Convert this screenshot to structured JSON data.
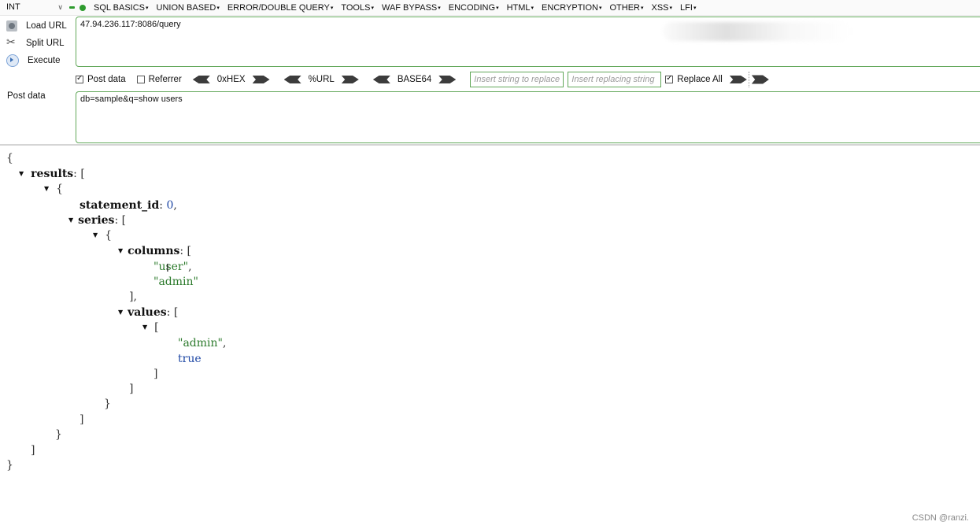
{
  "menubar": {
    "select_value": "INT",
    "items": [
      "SQL BASICS",
      "UNION BASED",
      "ERROR/DOUBLE QUERY",
      "TOOLS",
      "WAF BYPASS",
      "ENCODING",
      "HTML",
      "ENCRYPTION",
      "OTHER",
      "XSS",
      "LFI"
    ]
  },
  "actions": {
    "load_url": "Load URL",
    "split_url": "Split URL",
    "execute": "Execute"
  },
  "url_box": {
    "value": "47.94.236.117:8086/query"
  },
  "toolbar": {
    "post_data": "Post data",
    "referrer": "Referrer",
    "hex": "0xHEX",
    "url": "%URL",
    "base64": "BASE64",
    "find_placeholder": "Insert string to replace",
    "replace_placeholder": "Insert replacing string",
    "replace_all": "Replace All"
  },
  "post": {
    "label": "Post data",
    "value": "db=sample&q=show users"
  },
  "json": {
    "open_brace": "{",
    "close_brace": "}",
    "results_key": "results",
    "statement_id_key": "statement_id",
    "statement_id_value": "0",
    "series_key": "series",
    "columns_key": "columns",
    "col_1": "\"user\"",
    "col_2": "\"admin\"",
    "values_key": "values",
    "val_1": "\"admin\"",
    "val_2": "true"
  },
  "watermark": "CSDN @ranzi."
}
